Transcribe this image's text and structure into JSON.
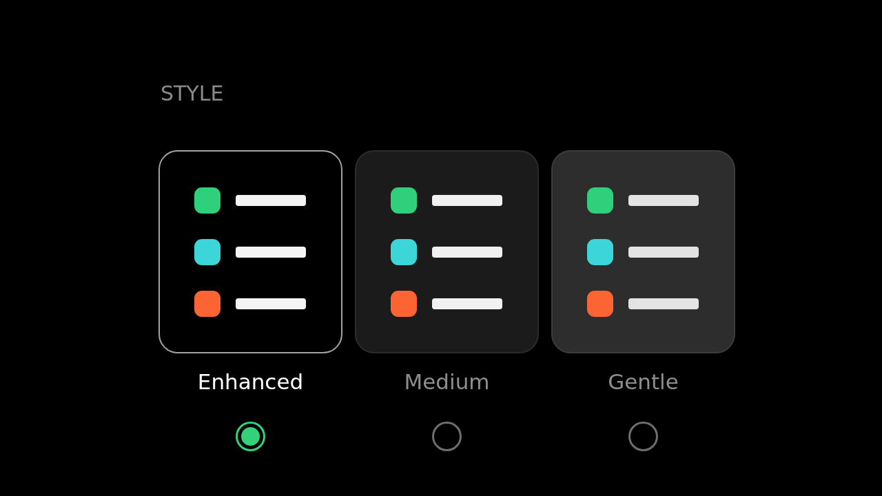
{
  "section_title": "STYLE",
  "options": [
    {
      "label": "Enhanced",
      "kind": "high",
      "selected": true,
      "preview_rows": [
        {
          "color": "#2fd07c"
        },
        {
          "color": "#3dd6d8"
        },
        {
          "color": "#fd6433"
        }
      ]
    },
    {
      "label": "Medium",
      "kind": "medium",
      "selected": false,
      "preview_rows": [
        {
          "color": "#2fd07c"
        },
        {
          "color": "#3dd6d8"
        },
        {
          "color": "#fd6433"
        }
      ]
    },
    {
      "label": "Gentle",
      "kind": "low",
      "selected": false,
      "preview_rows": [
        {
          "color": "#2fd07c"
        },
        {
          "color": "#3dd6d8"
        },
        {
          "color": "#fd6433"
        }
      ]
    }
  ]
}
